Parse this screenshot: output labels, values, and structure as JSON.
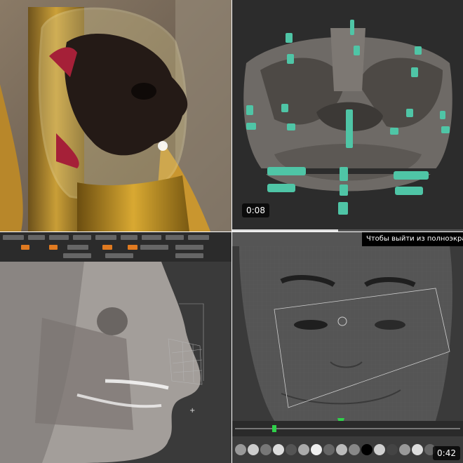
{
  "panels": {
    "top_left": {
      "subject": "glass-head-skull"
    },
    "top_right": {
      "subject": "skull-implant-pins",
      "timer": "0:08",
      "progress": 0.46
    },
    "bottom_left": {
      "subject": "zbrush-face-sculpt"
    },
    "bottom_right": {
      "subject": "face-wireframe-mesh",
      "timer": "0:42",
      "banner_text": "Чтобы выйти из полноэкранного режима,",
      "progress": 0.18
    }
  }
}
